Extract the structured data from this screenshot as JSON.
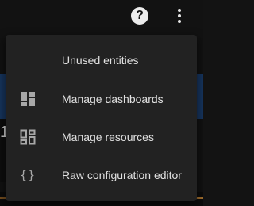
{
  "toolbar": {
    "help_icon": "help-circle-icon",
    "overflow_icon": "dots-vertical-icon",
    "help_glyph": "?"
  },
  "background": {
    "left_char": "1"
  },
  "menu": {
    "items": [
      {
        "label": "Unused entities",
        "icon": "none"
      },
      {
        "label": "Manage dashboards",
        "icon": "dashboard-icon"
      },
      {
        "label": "Manage resources",
        "icon": "resources-icon"
      },
      {
        "label": "Raw configuration editor",
        "icon": "code-braces-icon",
        "glyph": "{}"
      }
    ]
  },
  "colors": {
    "menu_background": "#222222",
    "text": "#e1e1e1",
    "icon": "#a8a8a8",
    "accent_band": "#16345c"
  }
}
